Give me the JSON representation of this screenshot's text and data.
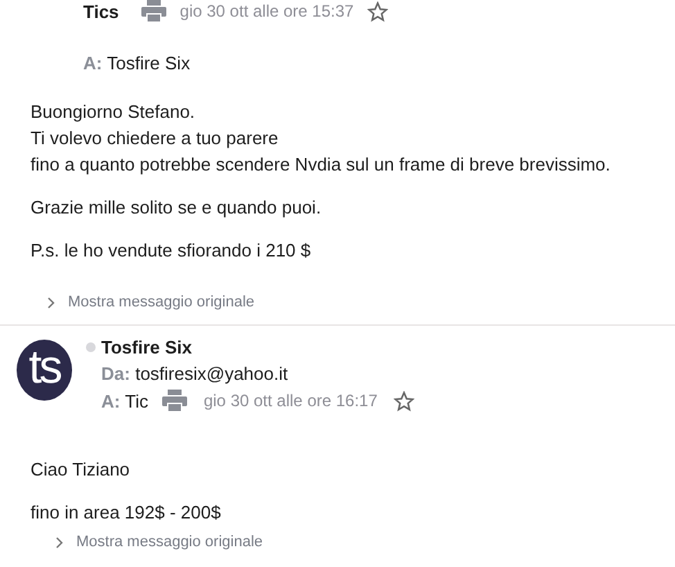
{
  "messages": [
    {
      "kind": "split",
      "sender": "Tics",
      "to_label": "A:",
      "to": "Tosfire Six",
      "date": "gio 30 ott alle ore 15:37",
      "starred": false,
      "paragraphs": [
        [
          "Buongiorno Stefano.",
          "Ti volevo chiedere a tuo parere",
          "fino a quanto potrebbe scendere Nvdia sul un frame di breve brevissimo."
        ],
        [
          "Grazie mille solito se e quando puoi."
        ],
        [
          "P.s. le ho vendute sfiorando i 210 $"
        ]
      ],
      "show_original": "Mostra messaggio originale"
    },
    {
      "kind": "stacked",
      "avatar": "ts",
      "online": false,
      "sender": "Tosfire Six",
      "from_label": "Da:",
      "from": "tosfiresix@yahoo.it",
      "to_label": "A:",
      "to": "Tic",
      "date": "gio 30 ott alle ore 16:17",
      "starred": false,
      "paragraphs": [
        [
          "Ciao Tiziano"
        ],
        [
          "fino in area 192$ - 200$"
        ]
      ],
      "show_original": "Mostra messaggio originale"
    }
  ]
}
